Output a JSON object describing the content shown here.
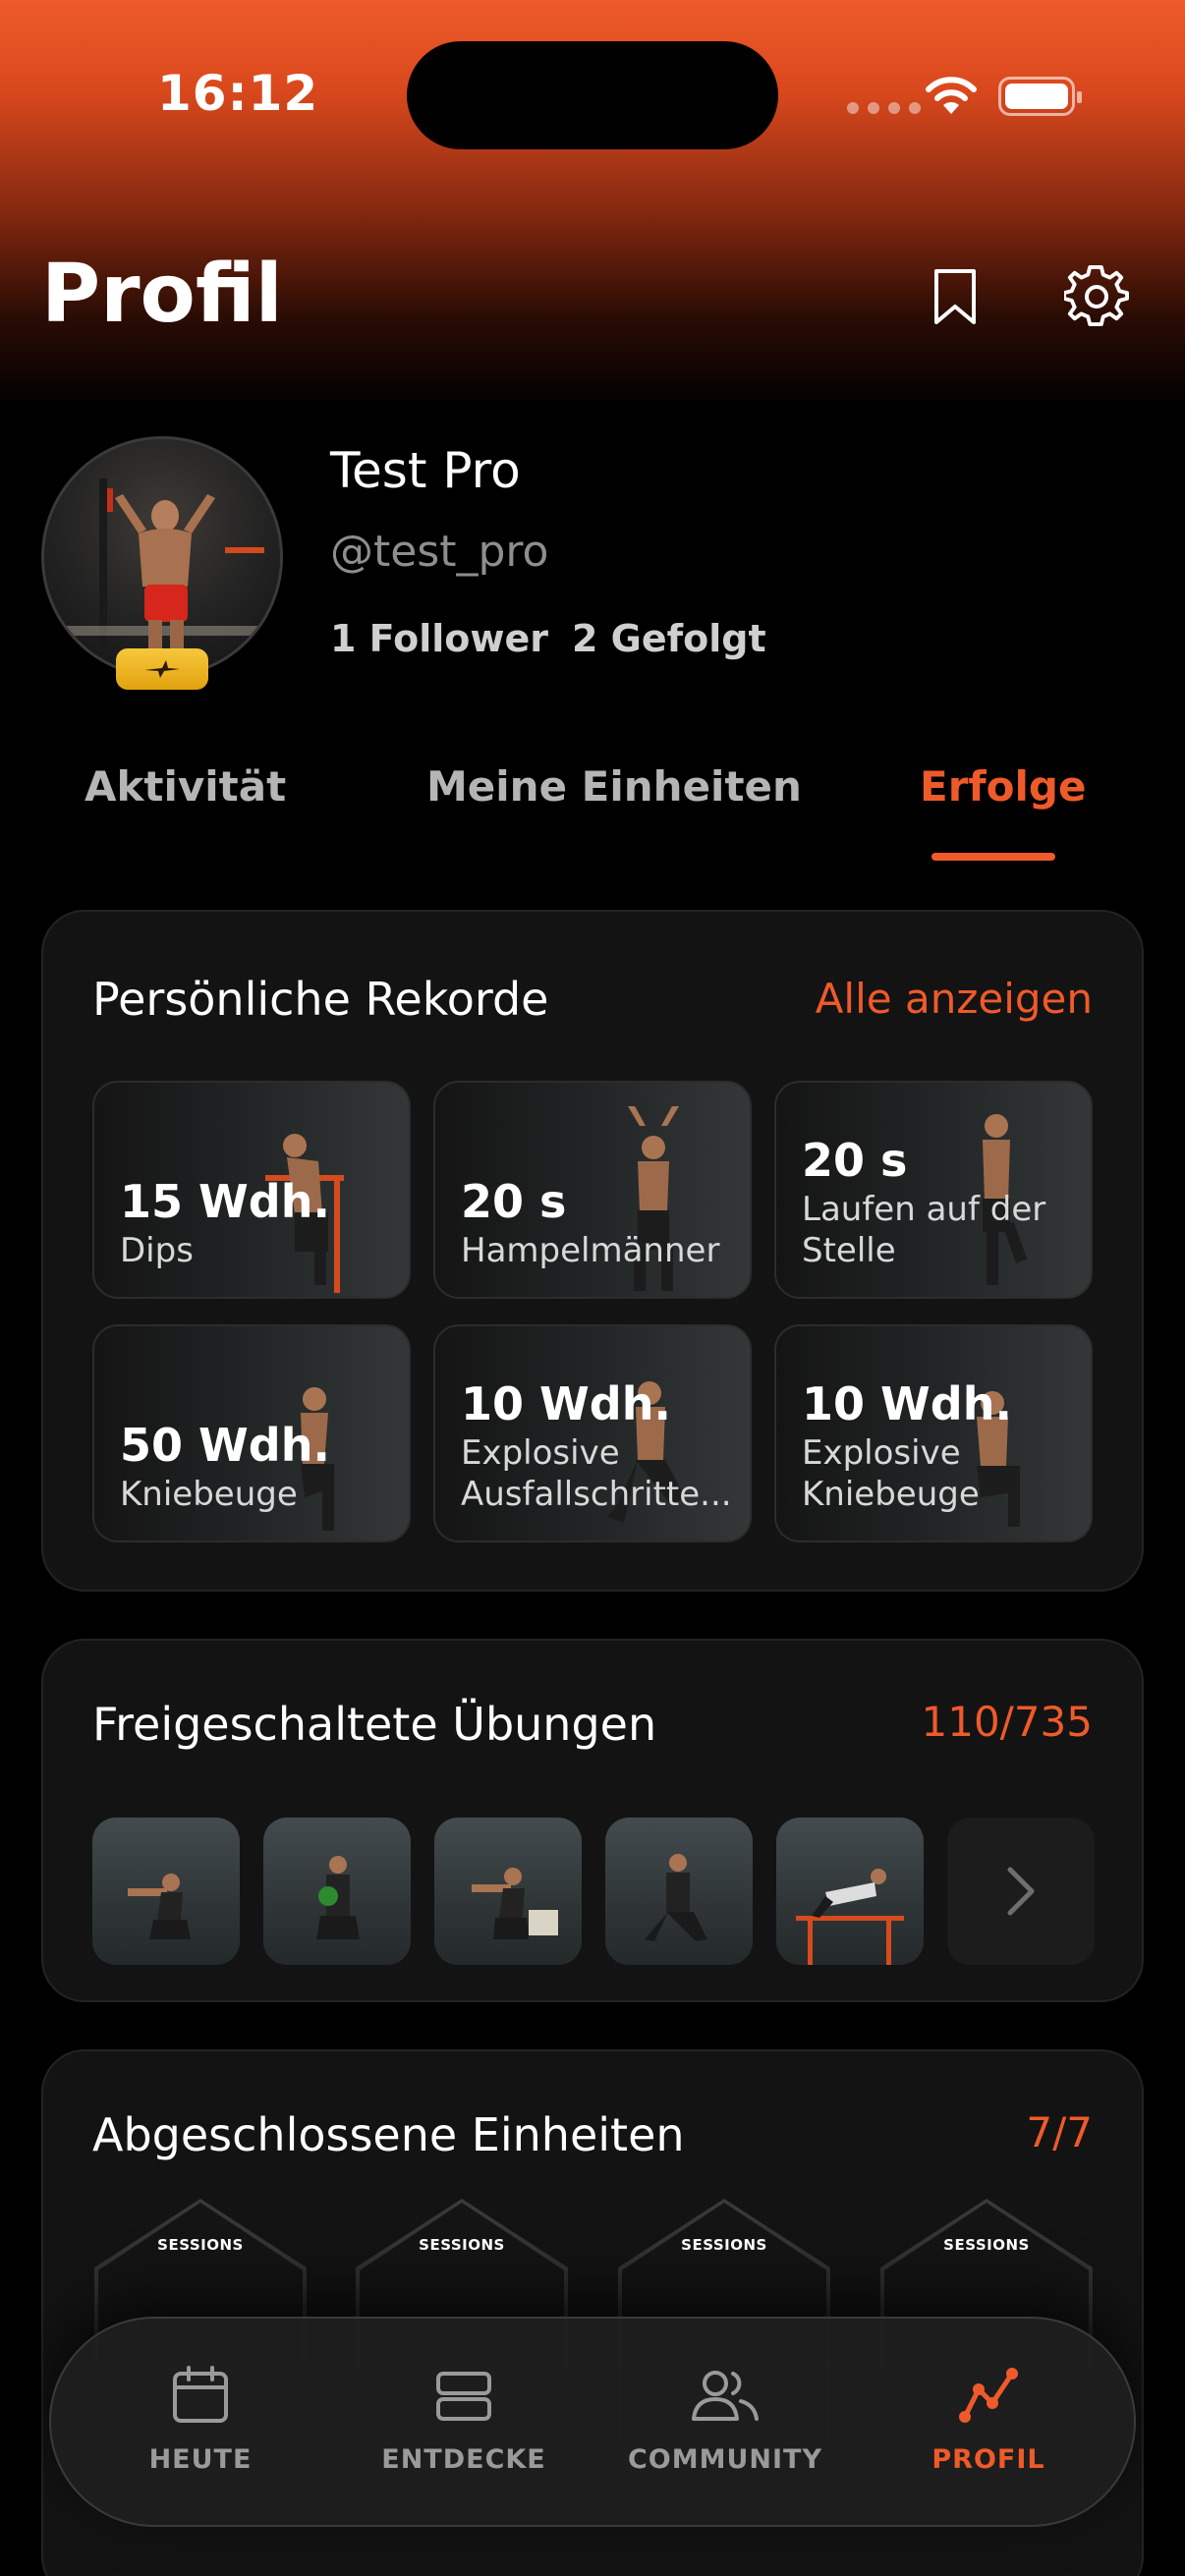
{
  "status_bar": {
    "time": "16:12"
  },
  "header": {
    "title": "Profil",
    "bookmark_icon": "bookmark-icon",
    "settings_icon": "gear-icon"
  },
  "profile": {
    "name": "Test Pro",
    "handle": "@test_pro",
    "followers": "1 Follower",
    "following": "2 Gefolgt"
  },
  "tabs": [
    {
      "label": "Aktivität",
      "active": false
    },
    {
      "label": "Meine Einheiten",
      "active": false
    },
    {
      "label": "Erfolge",
      "active": true
    }
  ],
  "records": {
    "title": "Persönliche Rekorde",
    "action": "Alle anzeigen",
    "items": [
      {
        "value": "15 Wdh.",
        "label": "Dips"
      },
      {
        "value": "20 s",
        "label": "Hampelmänner"
      },
      {
        "value": "20 s",
        "label": "Laufen auf der Stelle"
      },
      {
        "value": "50 Wdh.",
        "label": "Kniebeuge"
      },
      {
        "value": "10 Wdh.",
        "label": "Explosive Ausfallschritte..."
      },
      {
        "value": "10 Wdh.",
        "label": "Explosive Kniebeuge"
      }
    ]
  },
  "exercises": {
    "title": "Freigeschaltete Übungen",
    "count": "110/735"
  },
  "sessions": {
    "title": "Abgeschlossene Einheiten",
    "count": "7/7",
    "badge_label": "SESSIONS"
  },
  "nav": [
    {
      "label": "HEUTE",
      "icon": "calendar-icon",
      "active": false
    },
    {
      "label": "ENTDECKE",
      "icon": "stack-icon",
      "active": false
    },
    {
      "label": "COMMUNITY",
      "icon": "people-icon",
      "active": false
    },
    {
      "label": "PROFIL",
      "icon": "chart-line-icon",
      "active": true
    }
  ],
  "colors": {
    "accent": "#ef5a2a",
    "background": "#000000",
    "card": "#131313",
    "badge_gold": "#f2bb2a"
  }
}
